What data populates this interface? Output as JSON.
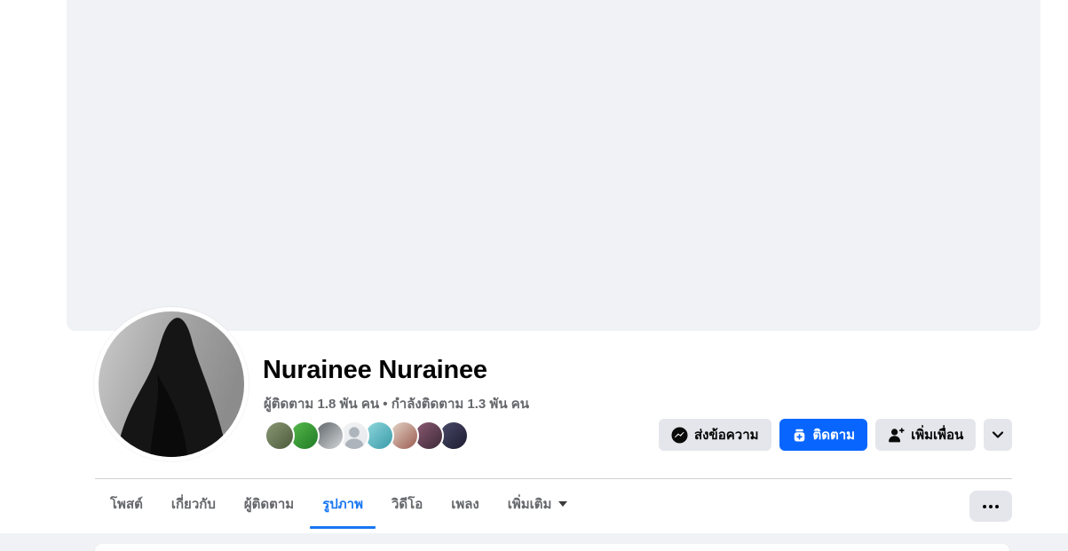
{
  "profile": {
    "name": "Nurainee Nurainee",
    "followers_summary": "ผู้ติดตาม 1.8 พัน คน • กำลังติดตาม 1.3 พัน คน"
  },
  "action_bar": {
    "message_label": "ส่งข้อความ",
    "follow_label": "ติดตาม",
    "add_friend_label": "เพิ่มเพื่อน"
  },
  "tabs": [
    {
      "label": "โพสต์",
      "active": false
    },
    {
      "label": "เกี่ยวกับ",
      "active": false
    },
    {
      "label": "ผู้ติดตาม",
      "active": false
    },
    {
      "label": "รูปภาพ",
      "active": true
    },
    {
      "label": "วิดีโอ",
      "active": false
    },
    {
      "label": "เพลง",
      "active": false
    },
    {
      "label": "เพิ่มเติม",
      "active": false,
      "has_dropdown": true
    }
  ],
  "friend_avatars": [
    {
      "name": "mutual-friend-1",
      "colors": [
        "#8a9775",
        "#4d5a3a"
      ]
    },
    {
      "name": "mutual-friend-2",
      "colors": [
        "#57b94c",
        "#1f7a24"
      ]
    },
    {
      "name": "mutual-friend-3",
      "colors": [
        "#5e6468",
        "#d4d7da"
      ]
    },
    {
      "name": "mutual-friend-4",
      "colors": [
        "#f2f3f5",
        "#e6e8ec"
      ],
      "default_person": true
    },
    {
      "name": "mutual-friend-5",
      "colors": [
        "#8fd8de",
        "#3a9aa8"
      ]
    },
    {
      "name": "mutual-friend-6",
      "colors": [
        "#e3d7c8",
        "#9c5a50"
      ]
    },
    {
      "name": "mutual-friend-7",
      "colors": [
        "#8c5a74",
        "#3c2a38"
      ]
    },
    {
      "name": "mutual-friend-8",
      "colors": [
        "#4a4a6a",
        "#1c1c30"
      ]
    }
  ],
  "icons": {
    "messenger": "messenger-bolt",
    "follow": "follow-plus-box",
    "add_friend": "person-plus",
    "chevron": "chevron-down",
    "more": "ellipsis",
    "more_tab": "caret-down"
  },
  "colors": {
    "accent_blue": "#0866FF",
    "tab_active_blue": "#1877F2",
    "button_gray": "#E4E6EB",
    "surface_gray": "#F0F2F5",
    "text_primary": "#050505",
    "text_secondary": "#65676B"
  }
}
